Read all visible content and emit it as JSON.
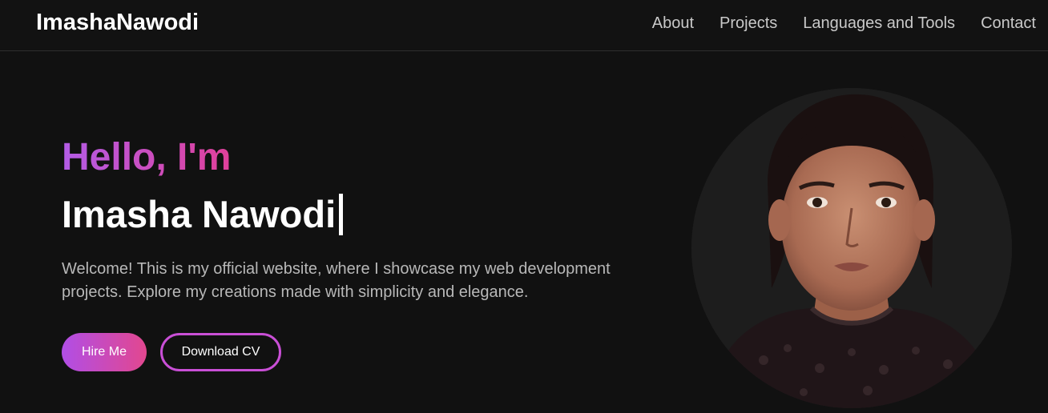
{
  "header": {
    "brand": "ImashaNawodi",
    "nav": [
      "About",
      "Projects",
      "Languages and Tools",
      "Contact"
    ]
  },
  "hero": {
    "greeting": "Hello, I'm",
    "name": "Imasha Nawodi",
    "intro": "Welcome! This is my official website, where I showcase my web development projects. Explore my creations made with simplicity and elegance.",
    "hire_label": "Hire Me",
    "cv_label": "Download CV"
  },
  "colors": {
    "background": "#111111",
    "gradient_start": "#b35ce6",
    "gradient_end": "#e0409a",
    "text_muted": "#b8b8b8"
  },
  "icons": {
    "portrait": "profile-photo"
  }
}
